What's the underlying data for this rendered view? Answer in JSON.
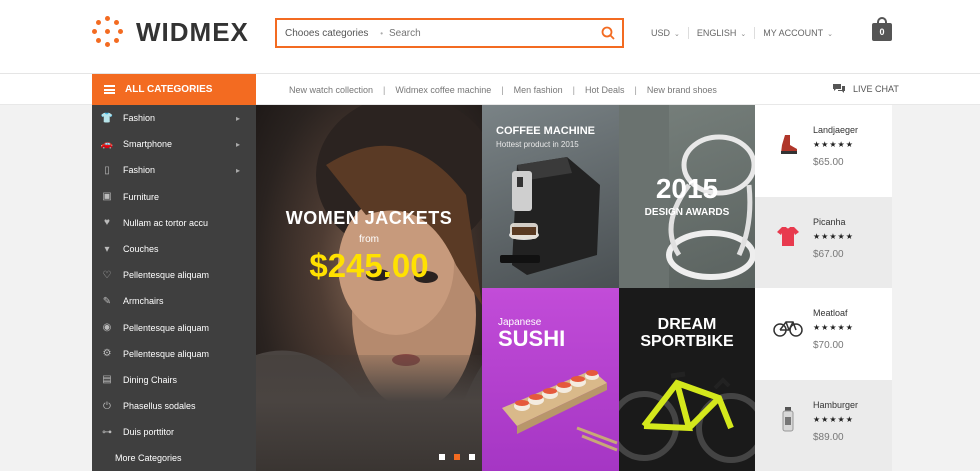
{
  "brand": {
    "name": "WIDMEX",
    "accent": "#f36b21"
  },
  "search": {
    "category": "Chooes categories",
    "placeholder": "Search"
  },
  "top_right": {
    "currency": "USD",
    "language": "ENGLISH",
    "account": "MY ACCOUNT"
  },
  "cart": {
    "count": "0"
  },
  "nav": {
    "all_categories": "ALL CATEGORIES",
    "links": [
      "New watch collection",
      "Widmex coffee machine",
      "Men fashion",
      "Hot Deals",
      "New brand shoes"
    ],
    "live_chat": "LIVE CHAT"
  },
  "sidebar": {
    "items": [
      {
        "label": "Fashion",
        "icon": "tshirt-icon",
        "has_sub": true
      },
      {
        "label": "Smartphone",
        "icon": "car-icon",
        "has_sub": true
      },
      {
        "label": "Fashion",
        "icon": "mouse-icon",
        "has_sub": true
      },
      {
        "label": "Furniture",
        "icon": "box-icon",
        "has_sub": false
      },
      {
        "label": "Nullam ac tortor accu",
        "icon": "heart-icon",
        "has_sub": false
      },
      {
        "label": "Couches",
        "icon": "lamp-icon",
        "has_sub": false
      },
      {
        "label": "Pellentesque aliquam",
        "icon": "heartbeat-icon",
        "has_sub": false
      },
      {
        "label": "Armchairs",
        "icon": "brush-icon",
        "has_sub": false
      },
      {
        "label": "Pellentesque aliquam",
        "icon": "compass-icon",
        "has_sub": false
      },
      {
        "label": "Pellentesque aliquam",
        "icon": "gear-icon",
        "has_sub": false
      },
      {
        "label": "Dining Chairs",
        "icon": "wallet-icon",
        "has_sub": false
      },
      {
        "label": "Phasellus sodales",
        "icon": "power-icon",
        "has_sub": false
      },
      {
        "label": "Duis porttitor",
        "icon": "dumbbell-icon",
        "has_sub": false
      }
    ],
    "more": "More Categories"
  },
  "hero": {
    "title": "WOMEN JACKETS",
    "from": "from",
    "price": "$245.00",
    "slides": 3,
    "active_slide": 2
  },
  "tiles": {
    "coffee": {
      "title": "COFFEE MACHINE",
      "subtitle": "Hottest product in 2015"
    },
    "design": {
      "year": "2015",
      "title": "DESIGN AWARDS"
    },
    "sushi": {
      "small": "Japanese",
      "big": "SUSHI"
    },
    "bike": {
      "line1": "DREAM",
      "line2": "SPORTBIKE"
    }
  },
  "products": [
    {
      "name": "Landjaeger",
      "stars": "★★★★★",
      "price": "$65.00",
      "icon": "shoe-icon"
    },
    {
      "name": "Picanha",
      "stars": "★★★★★",
      "price": "$67.00",
      "icon": "tshirt-icon"
    },
    {
      "name": "Meatloaf",
      "stars": "★★★★★",
      "price": "$70.00",
      "icon": "bicycle-icon"
    },
    {
      "name": "Hamburger",
      "stars": "★★★★★",
      "price": "$89.00",
      "icon": "bottle-icon"
    }
  ]
}
